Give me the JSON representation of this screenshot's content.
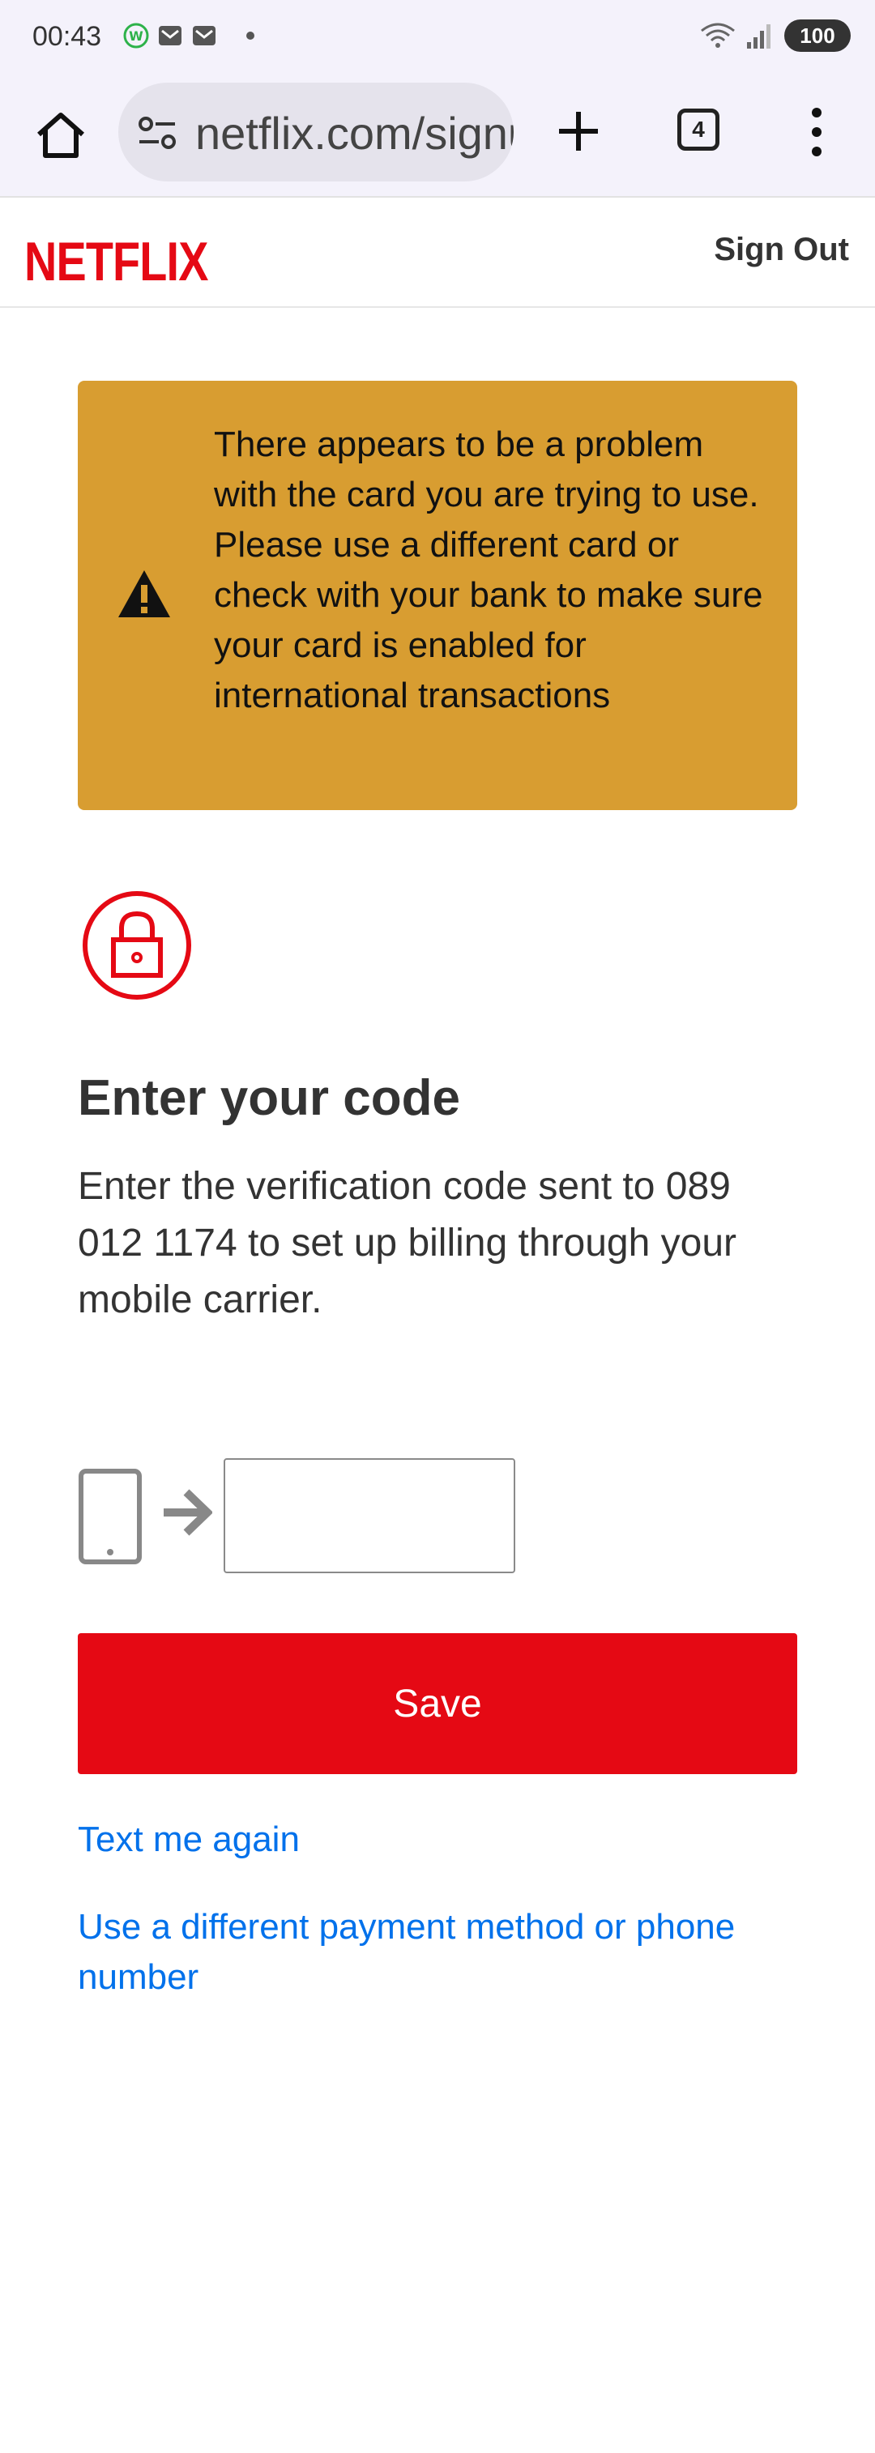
{
  "status_bar": {
    "time": "00:43",
    "battery": "100"
  },
  "browser": {
    "url": "netflix.com/signup",
    "tab_count": "4"
  },
  "header": {
    "logo": "NETFLIX",
    "sign_out": "Sign Out"
  },
  "warning": {
    "text": "There appears to be a problem with the card you are trying to use. Please use a different card or check with your bank to make sure your card is enabled for international transactions"
  },
  "main": {
    "title": "Enter your code",
    "subtitle": "Enter the verification code sent to 089 012 1174 to set up billing through your mobile carrier.",
    "code_value": "",
    "save_label": "Save",
    "text_again": "Text me again",
    "different_method": "Use a different payment method or phone number"
  },
  "colors": {
    "netflix_red": "#e50914",
    "warning_bg": "#d89d31",
    "link_blue": "#0071eb"
  }
}
